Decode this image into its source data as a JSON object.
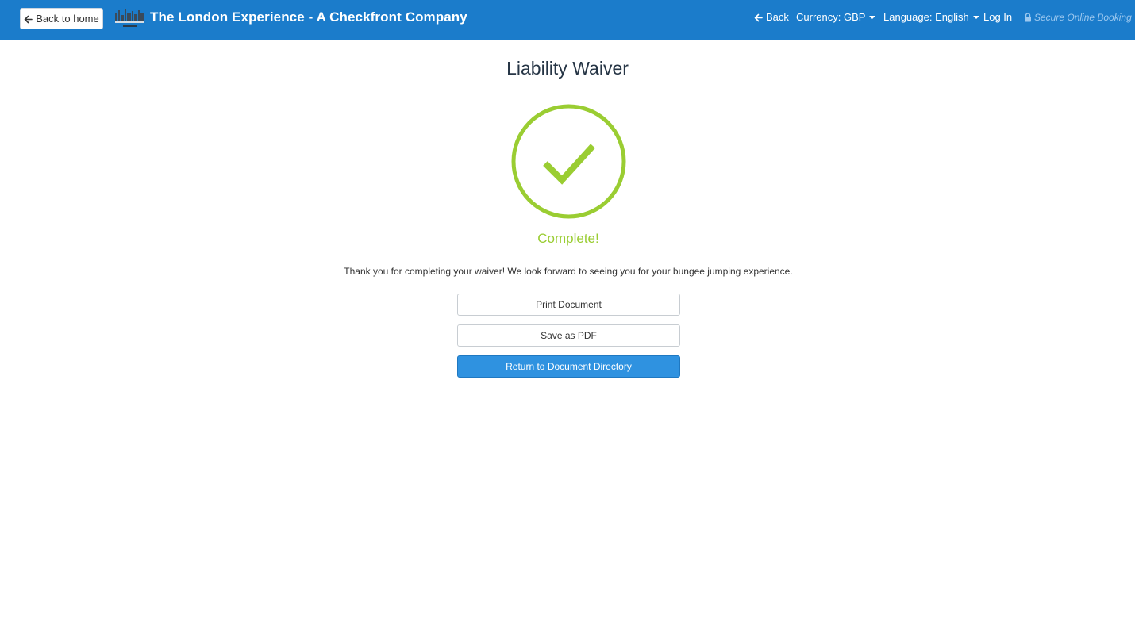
{
  "navbar": {
    "back_home_label": "Back to home",
    "brand_title": "The London Experience - A Checkfront Company",
    "back_label": "Back",
    "currency_label": "Currency: GBP",
    "language_label": "Language: English",
    "login_label": "Log In",
    "secure_label": "Secure Online Booking",
    "bar_color": "#1b7ccb"
  },
  "main": {
    "title": "Liability Waiver",
    "status_label": "Complete!",
    "status_color": "#9acd32",
    "message": "Thank you for completing your waiver! We look forward to seeing you for your bungee jumping experience.",
    "buttons": {
      "print_label": "Print Document",
      "pdf_label": "Save as PDF",
      "return_label": "Return to Document Directory"
    }
  },
  "icons": {
    "back_home": "arrow-left-icon",
    "back": "arrow-left-icon",
    "secure": "lock-icon",
    "status": "check-circle-icon"
  }
}
